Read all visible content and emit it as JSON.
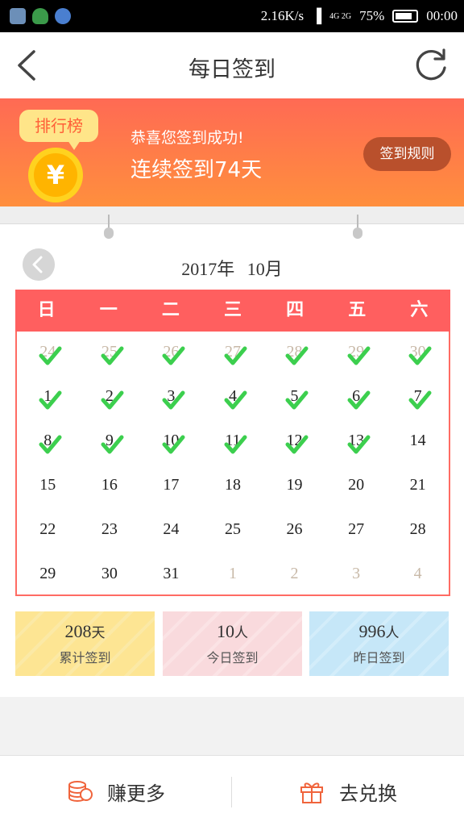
{
  "status_bar": {
    "speed": "2.16K/s",
    "battery": "75%",
    "time": "00:00",
    "network": "4G 2G"
  },
  "nav": {
    "title": "每日签到",
    "back_icon": "back-chevron-icon",
    "refresh_icon": "refresh-icon"
  },
  "banner": {
    "rank_label": "排行榜",
    "congrats": "恭喜您签到成功!",
    "streak": "连续签到74天",
    "rules_button": "签到规则",
    "gradient_colors": [
      "#ff6a54",
      "#ff8f3d"
    ]
  },
  "calendar": {
    "month_title": "2017年 10月",
    "weekdays": [
      "日",
      "一",
      "二",
      "三",
      "四",
      "五",
      "六"
    ],
    "days": [
      {
        "d": "24",
        "other": true,
        "checked": true
      },
      {
        "d": "25",
        "other": true,
        "checked": true
      },
      {
        "d": "26",
        "other": true,
        "checked": true
      },
      {
        "d": "27",
        "other": true,
        "checked": true
      },
      {
        "d": "28",
        "other": true,
        "checked": true
      },
      {
        "d": "29",
        "other": true,
        "checked": true
      },
      {
        "d": "30",
        "other": true,
        "checked": true
      },
      {
        "d": "1",
        "other": false,
        "checked": true
      },
      {
        "d": "2",
        "other": false,
        "checked": true
      },
      {
        "d": "3",
        "other": false,
        "checked": true
      },
      {
        "d": "4",
        "other": false,
        "checked": true
      },
      {
        "d": "5",
        "other": false,
        "checked": true
      },
      {
        "d": "6",
        "other": false,
        "checked": true
      },
      {
        "d": "7",
        "other": false,
        "checked": true
      },
      {
        "d": "8",
        "other": false,
        "checked": true
      },
      {
        "d": "9",
        "other": false,
        "checked": true
      },
      {
        "d": "10",
        "other": false,
        "checked": true
      },
      {
        "d": "11",
        "other": false,
        "checked": true
      },
      {
        "d": "12",
        "other": false,
        "checked": true
      },
      {
        "d": "13",
        "other": false,
        "checked": true
      },
      {
        "d": "14",
        "other": false,
        "checked": false
      },
      {
        "d": "15",
        "other": false,
        "checked": false
      },
      {
        "d": "16",
        "other": false,
        "checked": false
      },
      {
        "d": "17",
        "other": false,
        "checked": false
      },
      {
        "d": "18",
        "other": false,
        "checked": false
      },
      {
        "d": "19",
        "other": false,
        "checked": false
      },
      {
        "d": "20",
        "other": false,
        "checked": false
      },
      {
        "d": "21",
        "other": false,
        "checked": false
      },
      {
        "d": "22",
        "other": false,
        "checked": false
      },
      {
        "d": "23",
        "other": false,
        "checked": false
      },
      {
        "d": "24",
        "other": false,
        "checked": false
      },
      {
        "d": "25",
        "other": false,
        "checked": false
      },
      {
        "d": "26",
        "other": false,
        "checked": false
      },
      {
        "d": "27",
        "other": false,
        "checked": false
      },
      {
        "d": "28",
        "other": false,
        "checked": false
      },
      {
        "d": "29",
        "other": false,
        "checked": false
      },
      {
        "d": "30",
        "other": false,
        "checked": false
      },
      {
        "d": "31",
        "other": false,
        "checked": false
      },
      {
        "d": "1",
        "other": true,
        "checked": false
      },
      {
        "d": "2",
        "other": true,
        "checked": false
      },
      {
        "d": "3",
        "other": true,
        "checked": false
      },
      {
        "d": "4",
        "other": true,
        "checked": false
      }
    ],
    "header_color": "#ff5f5f",
    "check_color": "#3ccf4e"
  },
  "stats": [
    {
      "num": "208",
      "unit": "天",
      "label": "累计签到"
    },
    {
      "num": "10",
      "unit": "人",
      "label": "今日签到"
    },
    {
      "num": "996",
      "unit": "人",
      "label": "昨日签到"
    }
  ],
  "bottom_bar": {
    "earn_label": "赚更多",
    "earn_icon": "coin-stack-icon",
    "redeem_label": "去兑换",
    "redeem_icon": "gift-icon"
  }
}
